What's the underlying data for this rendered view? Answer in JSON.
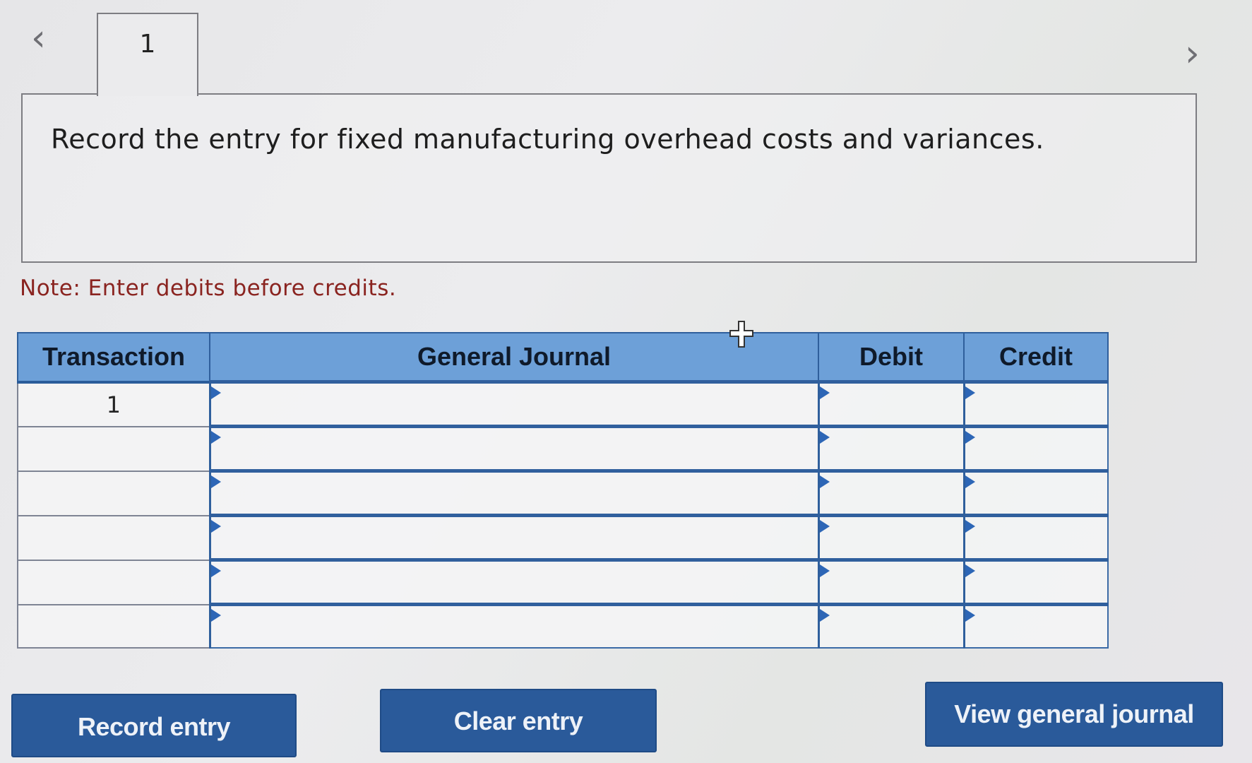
{
  "navigation": {
    "prev_glyph": "‹",
    "next_glyph": "›"
  },
  "tab": {
    "label": "1"
  },
  "question": {
    "text": "Record the entry for fixed manufacturing overhead costs and variances."
  },
  "note": "Note: Enter debits before credits.",
  "journal": {
    "headers": {
      "transaction": "Transaction",
      "general_journal": "General Journal",
      "debit": "Debit",
      "credit": "Credit"
    },
    "rows": [
      {
        "transaction": "1",
        "account": "",
        "debit": "",
        "credit": ""
      },
      {
        "transaction": "",
        "account": "",
        "debit": "",
        "credit": ""
      },
      {
        "transaction": "",
        "account": "",
        "debit": "",
        "credit": ""
      },
      {
        "transaction": "",
        "account": "",
        "debit": "",
        "credit": ""
      },
      {
        "transaction": "",
        "account": "",
        "debit": "",
        "credit": ""
      },
      {
        "transaction": "",
        "account": "",
        "debit": "",
        "credit": ""
      }
    ]
  },
  "buttons": {
    "record": "Record entry",
    "clear": "Clear entry",
    "view": "View general journal"
  },
  "colors": {
    "header_bg": "#6da0d8",
    "button_bg": "#2a5a9a",
    "note_text": "#8a2420",
    "marker": "#2d66b6"
  }
}
